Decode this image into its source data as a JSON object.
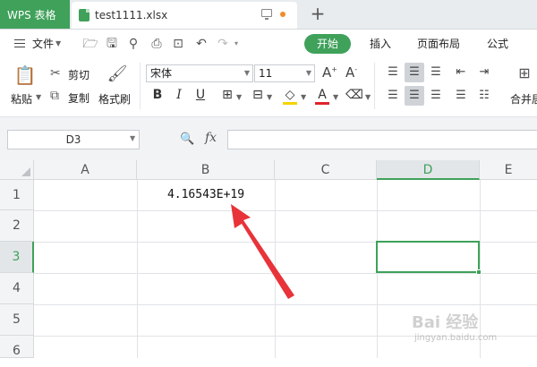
{
  "window": {
    "app_tab": "WPS 表格",
    "file_tab": "test1111.xlsx"
  },
  "menu": {
    "file": "文件",
    "tabs": [
      "开始",
      "插入",
      "页面布局",
      "公式"
    ]
  },
  "ribbon": {
    "paste": "粘贴",
    "cut": "剪切",
    "copy": "复制",
    "format_painter": "格式刷",
    "font_name": "宋体",
    "font_size": "11",
    "merge": "合并居"
  },
  "formula_bar": {
    "name_box": "D3",
    "fx": "fx",
    "formula": ""
  },
  "grid": {
    "columns": [
      "A",
      "B",
      "C",
      "D",
      "E"
    ],
    "rows": [
      "1",
      "2",
      "3",
      "4",
      "5",
      "6"
    ],
    "active_column": "D",
    "active_row": "3",
    "cell_b1": "4.16543E+19"
  },
  "watermark": {
    "brand": "Bai 经验",
    "url": "jingyan.baidu.com"
  },
  "colors": {
    "accent": "#3fa15a",
    "arrow": "#e8333a"
  }
}
